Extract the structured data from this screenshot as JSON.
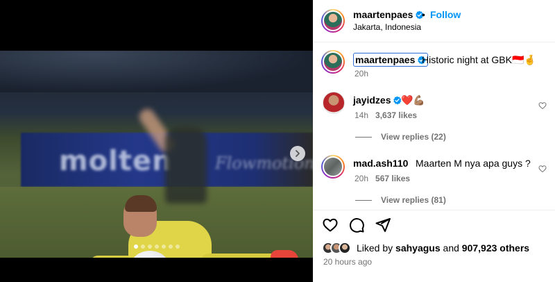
{
  "post": {
    "author": "maartenpaes",
    "follow_label": "Follow",
    "separator": "•",
    "location": "Jakarta, Indonesia",
    "caption_author": "maartenpaes",
    "caption": "Historic night at GBK🇮🇩🤞",
    "caption_time": "20h",
    "media": {
      "ad_brand": "molten",
      "ad_script": "Flowmotion",
      "carousel_count": 7,
      "carousel_active_index": 0
    }
  },
  "comments": [
    {
      "username": "jayidzes",
      "text": "❤️💪🏽",
      "time": "14h",
      "likes": "3,637 likes",
      "view_replies": "View replies (22)"
    },
    {
      "username": "mad.ash110",
      "text": "Maarten M nya apa guys ?",
      "time": "20h",
      "likes": "567 likes",
      "view_replies": "View replies (81)"
    }
  ],
  "likes": {
    "prefix": "Liked by",
    "user": "sahyagus",
    "conjunction": "and",
    "others": "907,923 others"
  },
  "post_time": "20 hours ago",
  "colors": {
    "accent": "#0095f6",
    "muted": "#737373",
    "verified": "#0095f6",
    "focus": "#2f6ed8"
  }
}
